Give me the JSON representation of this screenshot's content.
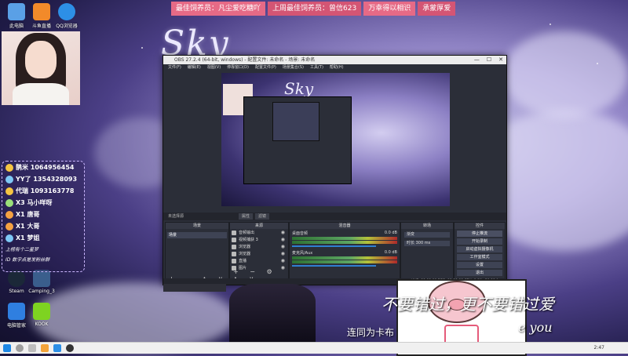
{
  "desktop_icons": [
    {
      "label": "此电脑"
    },
    {
      "label": "斗鱼直播"
    },
    {
      "label": "QQ浏览器"
    },
    {
      "label": "Steam"
    },
    {
      "label": "Camping_3"
    },
    {
      "label": "电脑管家"
    },
    {
      "label": "KOOK"
    }
  ],
  "ticker": [
    {
      "text": "最佳饲养员：凡尘爱吃糖吖"
    },
    {
      "text": "上周最佳饲养员：曾信623"
    },
    {
      "text": "万幸得以相识"
    },
    {
      "text": "承蒙厚爱"
    }
  ],
  "overlay_logo": "Sky",
  "gift_list": {
    "rows": [
      {
        "text": "鹊米 1064956454",
        "color": "#f5c542"
      },
      {
        "text": "YY了 1354328093",
        "color": "#7ec8f5"
      },
      {
        "text": "代瑞 1093163778",
        "color": "#f5c542"
      },
      {
        "text": "X3 马小咩呀",
        "color": "#9be07a"
      },
      {
        "text": "X1 唐哥",
        "color": "#f5a142"
      },
      {
        "text": "X1 大哥",
        "color": "#f5a142"
      },
      {
        "text": "X1 梦姐",
        "color": "#7ec8f5"
      }
    ],
    "footer_1": "上榜有个二星梦",
    "footer_2": "ID 数字点是发粉丝群"
  },
  "obs": {
    "title": "OBS 27.2.4 (64-bit, windows) - 配置文件: 未命名 - 场景: 未命名",
    "menu": [
      "文件(F)",
      "编辑(E)",
      "视图(V)",
      "停靠窗口(D)",
      "配置文件(P)",
      "场景集合(S)",
      "工具(T)",
      "帮助(H)"
    ],
    "scene_label": "未选择源",
    "tab_properties": "属性",
    "tab_filters": "滤镜",
    "docks": {
      "scenes": {
        "header": "场景",
        "items": [
          "场景"
        ]
      },
      "sources": {
        "header": "来源",
        "items": [
          "音频输出",
          "视频捕获 3",
          "浏览器",
          "浏览器",
          "直播",
          "图片"
        ]
      },
      "mixer": {
        "header": "混音器",
        "channels": [
          {
            "name": "桌面音频",
            "level": "0.0 dB"
          },
          {
            "name": "麦克风/Aux",
            "level": "0.0 dB"
          }
        ]
      },
      "transitions": {
        "header": "转场",
        "type": "渐变",
        "duration_label": "时长",
        "duration": "300 ms"
      },
      "controls": {
        "header": "控件",
        "buttons": [
          "停止推流",
          "开始录制",
          "启动虚拟摄像机",
          "工作室模式",
          "设置",
          "退出"
        ]
      }
    },
    "status": "LIVE: 00:00:00  REC: 00:00:00  CPU: 0.0%, 30.00 fps"
  },
  "overlay_quote": "不要错过，更不要错过爱",
  "overlay_you": "e you",
  "subtitle": "连同为卡布",
  "clock": "2:47",
  "colors": {
    "ticker": "#e66a86",
    "obs_bg": "#2b2e38",
    "accent": "#2f7fd1"
  }
}
